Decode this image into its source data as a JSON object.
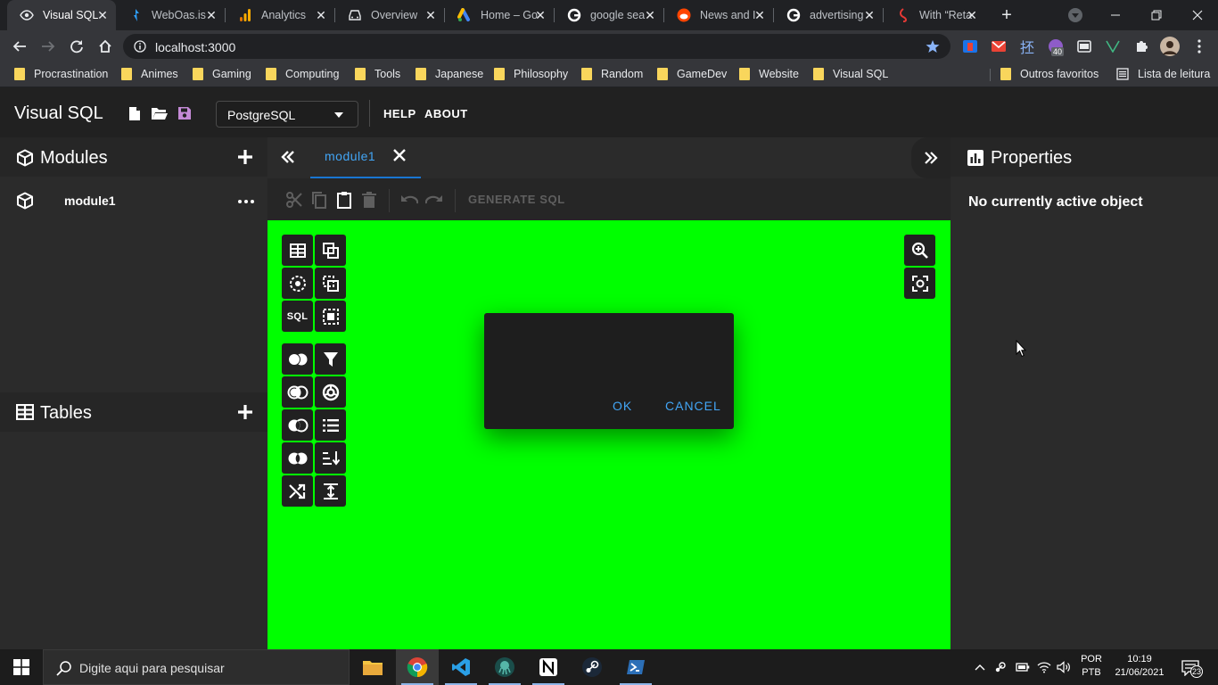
{
  "browser": {
    "tabs": [
      {
        "label": "Visual SQL",
        "icon": "eye-icon",
        "active": true
      },
      {
        "label": "WebOas.is",
        "icon": "weboasis-icon"
      },
      {
        "label": "Analytics",
        "icon": "analytics-icon"
      },
      {
        "label": "Overview",
        "icon": "overview-icon"
      },
      {
        "label": "Home – Go",
        "icon": "google-ads-icon"
      },
      {
        "label": "google sea",
        "icon": "google-icon"
      },
      {
        "label": "News and I",
        "icon": "reddit-icon"
      },
      {
        "label": "advertising",
        "icon": "google-icon"
      },
      {
        "label": "With “Reta",
        "icon": "site-icon"
      }
    ],
    "new_tab": "+",
    "url": "localhost:3000",
    "extension_badge": "40",
    "bookmarks": [
      "Procrastination",
      "Animes",
      "Gaming",
      "Computing",
      "Tools",
      "Japanese",
      "Philosophy",
      "Random",
      "GameDev",
      "Website",
      "Visual SQL"
    ],
    "other_bookmarks": "Outros favoritos",
    "reading_list": "Lista de leitura"
  },
  "app": {
    "title": "Visual SQL",
    "db_select": "PostgreSQL",
    "nav": {
      "help": "HELP",
      "about": "ABOUT"
    },
    "modules": {
      "title": "Modules",
      "items": [
        {
          "label": "module1"
        }
      ]
    },
    "tables": {
      "title": "Tables"
    },
    "editor": {
      "tab_label": "module1",
      "generate_sql": "GENERATE SQL",
      "palette_sql_label": "SQL"
    },
    "dialog": {
      "ok": "OK",
      "cancel": "CANCEL"
    },
    "properties": {
      "title": "Properties",
      "empty": "No currently active object"
    },
    "colors": {
      "canvas": "#00ff00",
      "accent": "#42a5f5",
      "appbar": "#212121",
      "panel": "#2b2b2b"
    }
  },
  "taskbar": {
    "search_placeholder": "Digite aqui para pesquisar",
    "apps": [
      "file-explorer-icon",
      "chrome-icon",
      "vscode-icon",
      "kraken-icon",
      "notion-icon",
      "steam-icon",
      "powershell-icon"
    ],
    "lang_top": "POR",
    "lang_bottom": "PTB",
    "time": "10:19",
    "date": "21/06/2021",
    "notifications": "23"
  }
}
